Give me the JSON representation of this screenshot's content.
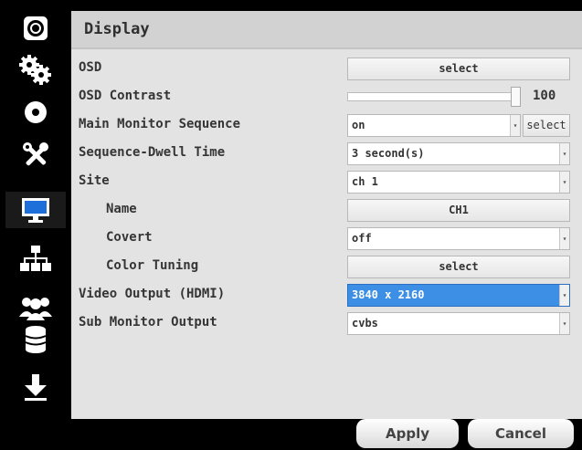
{
  "panel": {
    "title": "Display"
  },
  "sidebar": {
    "items": [
      {
        "icon": "camera-icon"
      },
      {
        "icon": "gear-icon"
      },
      {
        "icon": "disc-icon"
      },
      {
        "icon": "tools-icon"
      },
      {
        "icon": "monitor-icon",
        "active": true
      },
      {
        "icon": "network-icon"
      },
      {
        "icon": "users-icon"
      },
      {
        "icon": "database-icon"
      },
      {
        "icon": "download-icon"
      }
    ]
  },
  "settings": {
    "osd": {
      "label": "OSD",
      "button": "select"
    },
    "osd_contrast": {
      "label": "OSD Contrast",
      "value": "100",
      "level": 100
    },
    "main_monitor_sequence": {
      "label": "Main Monitor Sequence",
      "value": "on",
      "button": "select"
    },
    "sequence_dwell_time": {
      "label": "Sequence-Dwell Time",
      "value": "3 second(s)"
    },
    "site": {
      "label": "Site",
      "value": "ch 1"
    },
    "name": {
      "label": "Name",
      "button": "CH1"
    },
    "covert": {
      "label": "Covert",
      "value": "off"
    },
    "color_tuning": {
      "label": "Color Tuning",
      "button": "select"
    },
    "video_output": {
      "label": "Video Output (HDMI)",
      "value": "3840 x 2160"
    },
    "sub_monitor_output": {
      "label": "Sub Monitor Output",
      "value": "cvbs"
    }
  },
  "footer": {
    "apply": "Apply",
    "cancel": "Cancel"
  },
  "colors": {
    "selected": "#3d8fe6",
    "panel": "#e3e3e3",
    "background": "#000000"
  }
}
